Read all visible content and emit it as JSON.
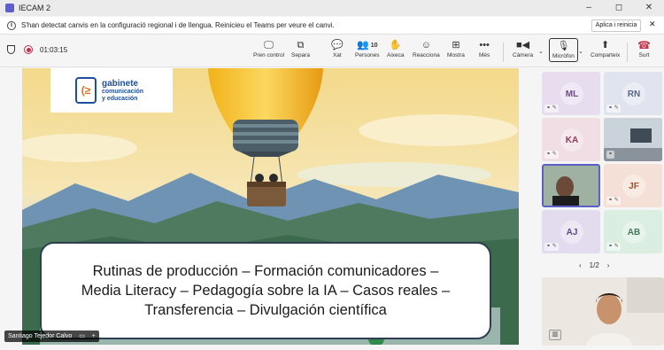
{
  "window": {
    "title": "IECAM 2",
    "controls": {
      "minimize": "–",
      "maximize": "◻",
      "close": "✕"
    }
  },
  "notice": {
    "icon": "info-icon",
    "message": "S'han detectat canvis en la configuració regional i de llengua. Reinicieu el Teams per veure el canvi.",
    "action_label": "Aplica i reinicia",
    "close": "✕"
  },
  "meeting": {
    "timer": "01:03:15"
  },
  "toolbar": {
    "share_label": "Pren control",
    "separate_label": "Separa",
    "chat_label": "Xat",
    "people_label": "Persones",
    "people_count": "10",
    "raise_label": "Aixeca",
    "react_label": "Reacciona",
    "view_label": "Mostra",
    "more_label": "Més",
    "camera_label": "Càmera",
    "mic_label": "Micròfon",
    "share_screen_label": "Comparteix",
    "leave_label": "Surt"
  },
  "slide": {
    "logo": {
      "line1": "gabinete",
      "line2": "comunicación",
      "line3": "y educación"
    },
    "caption": [
      "Rutinas de producción – Formación comunicadores –",
      "Media Literacy – Pedagogía sobre la IA – Casos reales –",
      "Transferencia – Divulgación científica"
    ]
  },
  "presenter": {
    "name": "Santiago Tejedor Calvo"
  },
  "participants": [
    {
      "initials": "ML",
      "bg": "#e8dcef",
      "fg": "#6b4a86"
    },
    {
      "initials": "RN",
      "bg": "#e0e4ee",
      "fg": "#5a6788"
    },
    {
      "initials": "KA",
      "bg": "#f1dde4",
      "fg": "#8c3d5c"
    },
    {
      "initials": "",
      "bg": "#6d7f8c",
      "fg": "#ffffff"
    },
    {
      "initials": "",
      "bg": "#9fb0a0",
      "fg": "#ffffff"
    },
    {
      "initials": "JF",
      "bg": "#f4e0d6",
      "fg": "#a2522c"
    },
    {
      "initials": "AJ",
      "bg": "#e3dcef",
      "fg": "#5e4a86"
    },
    {
      "initials": "AB",
      "bg": "#dbeee2",
      "fg": "#3f7a55"
    }
  ],
  "pager": {
    "label": "1/2"
  },
  "colors": {
    "accent": "#5b5fc7",
    "leave": "#c4314b",
    "brand": "#1f4e9a"
  }
}
